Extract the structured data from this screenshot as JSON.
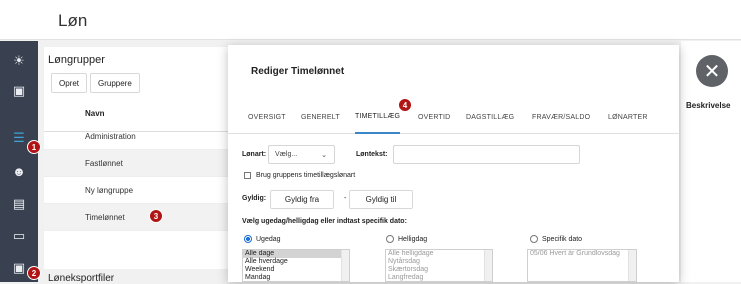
{
  "page": {
    "title": "Løn"
  },
  "sidebar": {
    "items": [
      {
        "icon": "sun-icon",
        "glyph": "☀"
      },
      {
        "icon": "briefcase-icon",
        "glyph": "▣"
      },
      {
        "icon": "sliders-icon",
        "glyph": "☰",
        "active": true
      },
      {
        "icon": "users-icon",
        "glyph": "☻"
      },
      {
        "icon": "list-icon",
        "glyph": "▤"
      },
      {
        "icon": "id-card-icon",
        "glyph": "▭"
      },
      {
        "icon": "money-icon",
        "glyph": "▣"
      }
    ]
  },
  "badges": [
    "1",
    "2",
    "3",
    "4"
  ],
  "lonngrupper": {
    "title": "Løngrupper",
    "buttons": {
      "create": "Opret",
      "groups": "Gruppere"
    },
    "column": "Navn",
    "rows": [
      "Administration",
      "Fastlønnet",
      "Ny løngruppe",
      "Timelønnet"
    ]
  },
  "right": {
    "description_header": "Beskrivelse"
  },
  "bottom": {
    "title": "Løneksportfiler"
  },
  "modal": {
    "title": "Rediger Timelønnet",
    "tabs": [
      "OVERSIGT",
      "GENERELT",
      "TIMETILLÆG",
      "OVERTID",
      "DAGSTILLÆG",
      "FRAVÆR/SALDO",
      "LØNARTER"
    ],
    "active_tab": "TIMETILLÆG",
    "form": {
      "lonart_label": "Lønart:",
      "lonart_value": "Vælg...",
      "lontekst_label": "Løntekst:",
      "lontekst_value": "",
      "use_group_label": "Brug gruppens timetillægslønart",
      "gyldig_label": "Gyldig:",
      "gyldig_fra": "Gyldig fra",
      "separator": "-",
      "gyldig_til": "Gyldig til",
      "choose_label": "Vælg ugedag/helligdag eller indtast specifik dato:",
      "radio_ugedag": "Ugedag",
      "radio_helligdag": "Helligdag",
      "radio_specifik": "Specifik dato",
      "ugedag_options": [
        "Alle dage",
        "Alle hverdage",
        "Weekend",
        "Mandag"
      ],
      "helligdag_options": [
        "Alle helligdage",
        "Nytårsdag",
        "Skærtorsdag",
        "Langfredag"
      ],
      "specifik_options": [
        "05/06 Hvert år Grundlovsdag"
      ]
    }
  },
  "close_label": "✕"
}
